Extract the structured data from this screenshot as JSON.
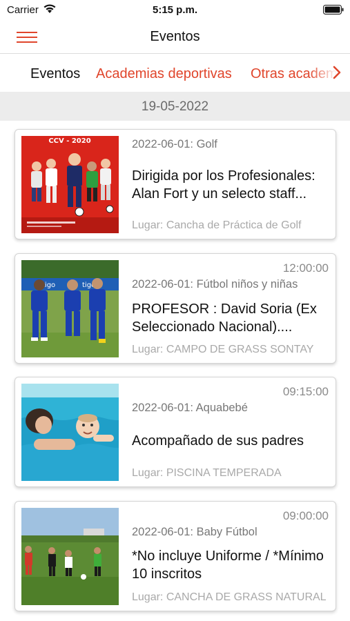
{
  "status_bar": {
    "carrier": "Carrier",
    "time": "5:15 p.m."
  },
  "header": {
    "title": "Eventos"
  },
  "tabs": [
    {
      "label": "Eventos",
      "active": true
    },
    {
      "label": "Academias deportivas",
      "active": false
    },
    {
      "label": "Otras academias",
      "active": false
    }
  ],
  "date_header": "19-05-2022",
  "events": [
    {
      "time": "",
      "meta": "2022-06-01: Golf",
      "title": "Dirigida por los Profesionales: Alan Fort y un selecto staff...",
      "place": "Lugar: Cancha de Práctica de Golf",
      "image": "golf-event-poster"
    },
    {
      "time": "12:00:00",
      "meta": "2022-06-01: Fútbol niños y niñas",
      "title": "PROFESOR : David Soria (Ex Seleccionado Nacional)....",
      "place": "Lugar: CAMPO DE  GRASS  SONTAY",
      "image": "kids-football-photo"
    },
    {
      "time": "09:15:00",
      "meta": "2022-06-01: Aquabebé",
      "title": "Acompañado de sus padres",
      "place": "Lugar: PISCINA TEMPERADA",
      "image": "baby-swimming-photo"
    },
    {
      "time": "09:00:00",
      "meta": "2022-06-01: Baby Fútbol",
      "title": "*No incluye Uniforme / *Mínimo 10 inscritos",
      "place": "Lugar: CANCHA DE GRASS NATURAL",
      "image": "baby-football-photo"
    }
  ],
  "theme": {
    "accent": "#e0452b",
    "date_bar_bg": "#ececec"
  },
  "icons": {
    "menu": "hamburger-icon",
    "wifi": "wifi-icon",
    "battery": "battery-icon",
    "tabs_more": "chevron-right-icon"
  }
}
